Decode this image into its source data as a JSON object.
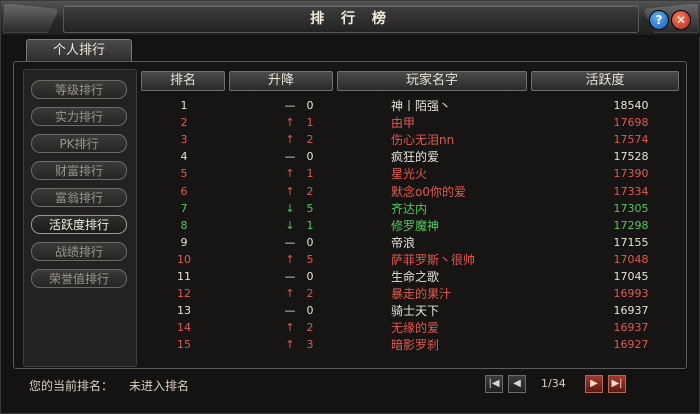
{
  "window": {
    "title": "排 行 榜"
  },
  "titlebar": {
    "help": "?",
    "close": "✕"
  },
  "tabs": [
    {
      "label": "个人排行"
    }
  ],
  "side": [
    {
      "label": "等级排行",
      "active": false
    },
    {
      "label": "实力排行",
      "active": false
    },
    {
      "label": "PK排行",
      "active": false
    },
    {
      "label": "财富排行",
      "active": false
    },
    {
      "label": "富翁排行",
      "active": false
    },
    {
      "label": "活跃度排行",
      "active": true
    },
    {
      "label": "战绩排行",
      "active": false
    },
    {
      "label": "荣誉值排行",
      "active": false
    }
  ],
  "table": {
    "headers": {
      "rank": "排名",
      "change": "升降",
      "name": "玩家名字",
      "score": "活跃度"
    },
    "colors": {
      "white": "#e6e2d6",
      "red": "#e05a4e",
      "green": "#52c85a"
    },
    "rows": [
      {
        "rank": "1",
        "arrow": "—",
        "change": "0",
        "name": "神丨陌强丶",
        "score": "18540",
        "color": "white"
      },
      {
        "rank": "2",
        "arrow": "↑",
        "change": "1",
        "name": "由甲",
        "score": "17698",
        "color": "red"
      },
      {
        "rank": "3",
        "arrow": "↑",
        "change": "2",
        "name": "伤心无泪nn",
        "score": "17574",
        "color": "red"
      },
      {
        "rank": "4",
        "arrow": "—",
        "change": "0",
        "name": "疯狂的爱",
        "score": "17528",
        "color": "white"
      },
      {
        "rank": "5",
        "arrow": "↑",
        "change": "1",
        "name": "星光火",
        "score": "17390",
        "color": "red"
      },
      {
        "rank": "6",
        "arrow": "↑",
        "change": "2",
        "name": "默念o0你的爱",
        "score": "17334",
        "color": "red"
      },
      {
        "rank": "7",
        "arrow": "↓",
        "change": "5",
        "name": "齐达内",
        "score": "17305",
        "color": "green"
      },
      {
        "rank": "8",
        "arrow": "↓",
        "change": "1",
        "name": "修罗魔神",
        "score": "17298",
        "color": "green"
      },
      {
        "rank": "9",
        "arrow": "—",
        "change": "0",
        "name": "帝浪",
        "score": "17155",
        "color": "white"
      },
      {
        "rank": "10",
        "arrow": "↑",
        "change": "5",
        "name": "萨菲罗斯丶很帅",
        "score": "17048",
        "color": "red"
      },
      {
        "rank": "11",
        "arrow": "—",
        "change": "0",
        "name": "生命之歌",
        "score": "17045",
        "color": "white"
      },
      {
        "rank": "12",
        "arrow": "↑",
        "change": "2",
        "name": "暴走的果汁",
        "score": "16993",
        "color": "red"
      },
      {
        "rank": "13",
        "arrow": "—",
        "change": "0",
        "name": "骑士天下",
        "score": "16937",
        "color": "white"
      },
      {
        "rank": "14",
        "arrow": "↑",
        "change": "2",
        "name": "无缘的爱",
        "score": "16937",
        "color": "red"
      },
      {
        "rank": "15",
        "arrow": "↑",
        "change": "3",
        "name": "暗影罗刹",
        "score": "16927",
        "color": "red"
      }
    ]
  },
  "footer": {
    "label": "您的当前排名：",
    "value": "未进入排名",
    "page": "1/34",
    "first_icon": "first-page-icon",
    "prev_icon": "prev-page-icon",
    "next_icon": "next-page-icon",
    "last_icon": "last-page-icon"
  }
}
